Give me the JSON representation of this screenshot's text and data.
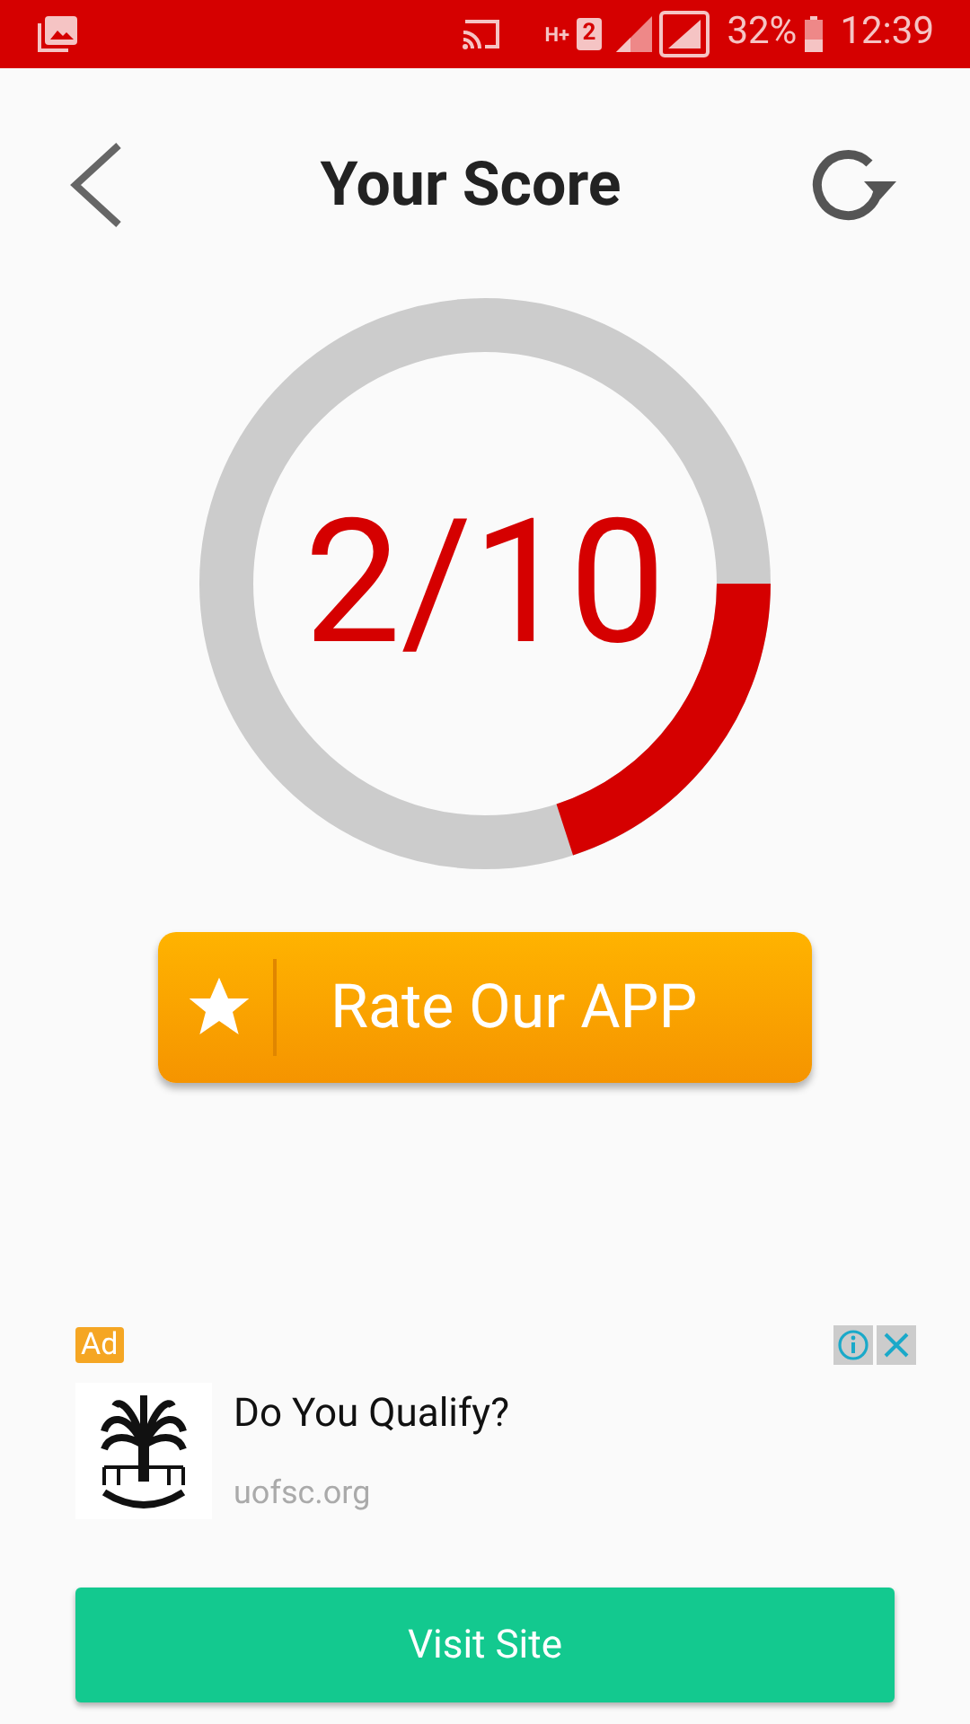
{
  "status_bar": {
    "network": "H+",
    "sim": "2",
    "battery": "32%",
    "time": "12:39"
  },
  "header": {
    "title": "Your Score"
  },
  "score": {
    "text": "2/10",
    "level": 0.2
  },
  "rate_button": {
    "label": "Rate Our APP"
  },
  "ad": {
    "badge": "Ad",
    "headline": "Do You Qualify?",
    "domain": "uofsc.org",
    "button": "Visit Site"
  }
}
